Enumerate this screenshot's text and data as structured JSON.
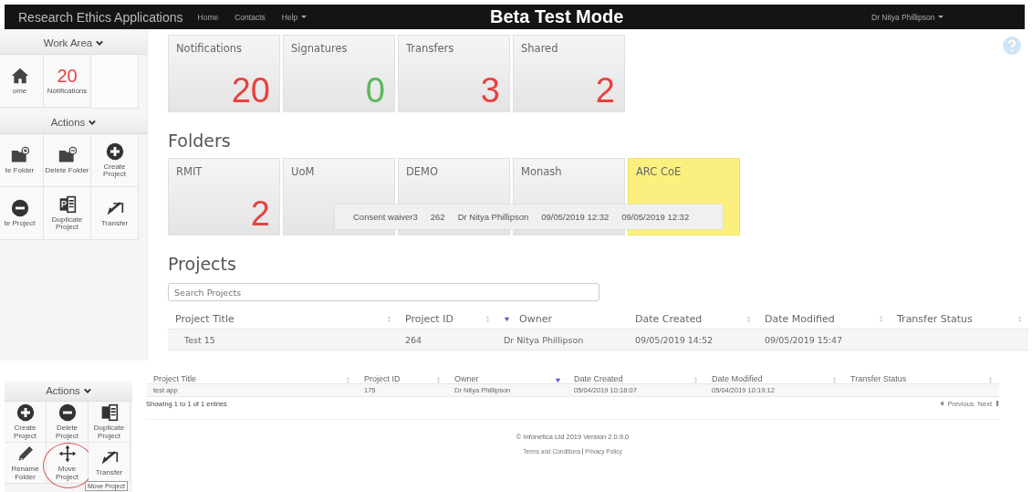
{
  "navbar": {
    "brand": "Research Ethics Applications",
    "links": [
      {
        "label": "Home",
        "dropdown": false
      },
      {
        "label": "Contacts",
        "dropdown": false
      },
      {
        "label": "Help",
        "dropdown": true
      }
    ],
    "mode": "Beta Test Mode",
    "user": "Dr Nitya Phillipson"
  },
  "sidebar": {
    "work_area": {
      "title": "Work Area",
      "items": [
        {
          "kind": "home",
          "label": "ome"
        },
        {
          "kind": "count",
          "count": "20",
          "label": "Notifications"
        }
      ]
    },
    "actions": {
      "title": "Actions",
      "items": [
        {
          "kind": "create-folder",
          "label": "te Folder"
        },
        {
          "kind": "delete-folder",
          "label": "Delete Folder"
        },
        {
          "kind": "create-project",
          "label": "Create Project"
        },
        {
          "kind": "delete-project",
          "label": "te Project"
        },
        {
          "kind": "duplicate-project",
          "label": "Duplicate Project"
        },
        {
          "kind": "transfer",
          "label": "Transfer"
        }
      ]
    }
  },
  "summary_tiles": [
    {
      "label": "Notifications",
      "count": "20",
      "color": "#e8413f"
    },
    {
      "label": "Signatures",
      "count": "0",
      "color": "#5cb85c"
    },
    {
      "label": "Transfers",
      "count": "3",
      "color": "#e8413f"
    },
    {
      "label": "Shared",
      "count": "2",
      "color": "#e8413f"
    }
  ],
  "folders": {
    "title": "Folders",
    "items": [
      {
        "label": "RMIT",
        "count": "2",
        "color": "#e8413f",
        "highlighted": false
      },
      {
        "label": "UoM",
        "highlighted": false
      },
      {
        "label": "DEMO",
        "highlighted": false
      },
      {
        "label": "Monash",
        "highlighted": false
      },
      {
        "label": "ARC CoE",
        "highlighted": true
      }
    ]
  },
  "dragged_row": [
    "Consent waiver3",
    "262",
    "Dr Nitya Phillipson",
    "09/05/2019 12:32",
    "09/05/2019 12:32"
  ],
  "projects": {
    "title": "Projects",
    "search": {
      "placeholder": "Search Projects"
    },
    "columns": [
      {
        "label": "Project Title",
        "sorted": false
      },
      {
        "label": "Project ID",
        "sorted": false
      },
      {
        "label": "Owner",
        "sorted": true
      },
      {
        "label": "Date Created",
        "sorted": false
      },
      {
        "label": "Date Modified",
        "sorted": false
      },
      {
        "label": "Transfer Status",
        "sorted": false
      }
    ],
    "rows": [
      [
        "Test 15",
        "264",
        "Dr Nitya Phillipson",
        "09/05/2019 14:52",
        "09/05/2019 15:47",
        ""
      ]
    ]
  },
  "inset": {
    "actions": {
      "title": "Actions",
      "items": [
        {
          "kind": "create-project",
          "label": "Create Project",
          "highlighted": false
        },
        {
          "kind": "delete-project",
          "label": "Delete Project",
          "highlighted": false
        },
        {
          "kind": "duplicate-project",
          "label": "Duplicate Project",
          "highlighted": false
        },
        {
          "kind": "rename-folder",
          "label": "Rename Folder",
          "highlighted": false
        },
        {
          "kind": "move-project",
          "label": "Move Project",
          "highlighted": true
        },
        {
          "kind": "transfer",
          "label": "Transfer",
          "highlighted": false
        }
      ]
    },
    "tooltip": "Move Project",
    "columns": [
      {
        "label": "Project Title",
        "sorted": false
      },
      {
        "label": "Project ID",
        "sorted": false
      },
      {
        "label": "Owner",
        "sorted": true
      },
      {
        "label": "Date Created",
        "sorted": false
      },
      {
        "label": "Date Modified",
        "sorted": false
      },
      {
        "label": "Transfer Status",
        "sorted": false
      }
    ],
    "rows": [
      [
        "test app",
        "175",
        "Dr Nitya Phillipson",
        "05/04/2019 10:18:07",
        "05/04/2019 10:19:12",
        ""
      ]
    ],
    "info": "Showing 1 to 1 of 1 entries",
    "pager": [
      "Previous",
      "Next"
    ],
    "footer": {
      "copyright": "© Infonetica Ltd 2019 Version 2.0.9.0",
      "links": [
        "Terms and Conditions",
        "Privacy Policy"
      ]
    }
  }
}
